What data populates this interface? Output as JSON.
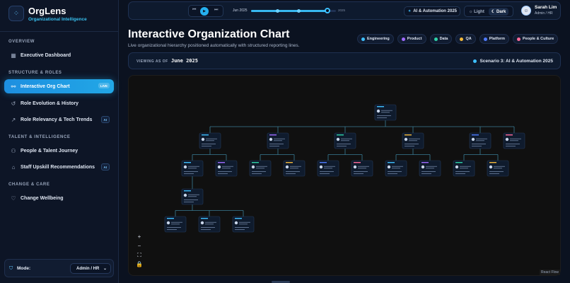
{
  "brand": {
    "name": "OrgLens",
    "tagline": "Organizational Intelligence",
    "logo_icon": "network-icon"
  },
  "sidebar": {
    "sections": [
      {
        "label": "OVERVIEW"
      },
      {
        "label": "STRUCTURE & ROLES"
      },
      {
        "label": "TALENT & INTELLIGENCE"
      },
      {
        "label": "CHANGE & CARE"
      }
    ],
    "items": [
      {
        "label": "Executive Dashboard",
        "icon": "grid-icon"
      },
      {
        "label": "Interactive Org Chart",
        "icon": "org-chart-icon",
        "badge": "LIVE",
        "active": true
      },
      {
        "label": "Role Evolution & History",
        "icon": "history-icon"
      },
      {
        "label": "Role Relevancy & Tech Trends",
        "icon": "trend-icon",
        "badge": "AI"
      },
      {
        "label": "People & Talent Journey",
        "icon": "people-icon"
      },
      {
        "label": "Staff Upskill Recommendations",
        "icon": "graduation-cap-icon",
        "badge": "AI"
      },
      {
        "label": "Change Wellbeing",
        "icon": "heart-icon"
      }
    ],
    "mode": {
      "label": "Mode:",
      "value": "Admin / HR"
    }
  },
  "topbar": {
    "timeline": {
      "start": "Jun 2025",
      "end": "2025",
      "progress": 0.9
    },
    "scenario": "AI & Automation 2025",
    "theme": {
      "light": "Light",
      "dark": "Dark",
      "selected": "Dark"
    },
    "user": {
      "name": "Sarah Lim",
      "role": "Admin / HR"
    }
  },
  "header": {
    "title": "Interactive Organization Chart",
    "subtitle": "Live organizational hierarchy positioned automatically with structured reporting lines."
  },
  "legend": [
    {
      "label": "Engineering",
      "color": "#3ec0ff"
    },
    {
      "label": "Product",
      "color": "#a06bff"
    },
    {
      "label": "Data",
      "color": "#2fd3a8"
    },
    {
      "label": "QA",
      "color": "#f4b93a"
    },
    {
      "label": "Platform",
      "color": "#4f7bff"
    },
    {
      "label": "People & Culture",
      "color": "#ff6b9a"
    }
  ],
  "viewing": {
    "label": "VIEWING AS OF",
    "date": "June 2025",
    "scenario": "Scenario 3: AI & Automation 2025"
  },
  "canvas": {
    "zoom_controls": [
      "+",
      "−",
      "⛶",
      "🔒"
    ],
    "attribution": "React Flow"
  }
}
